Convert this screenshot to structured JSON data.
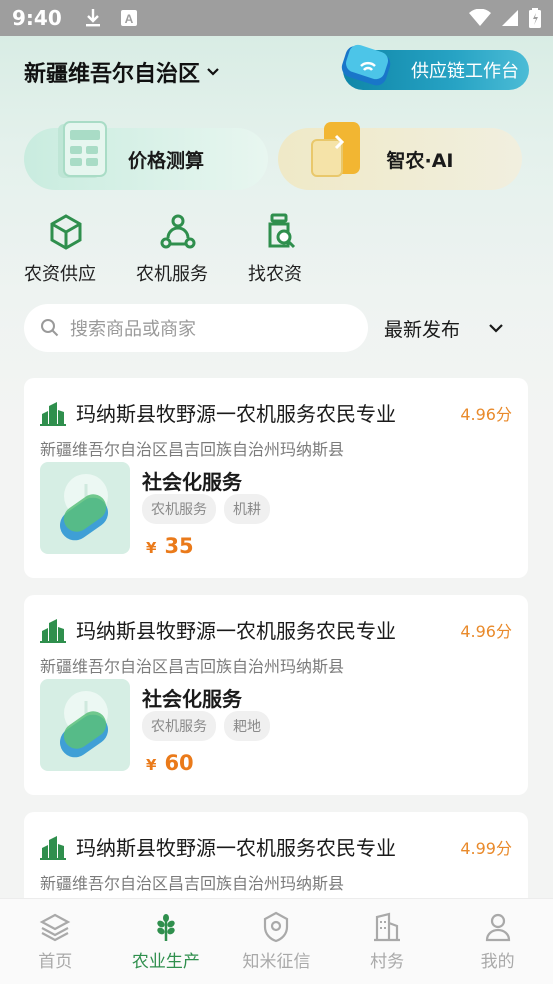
{
  "status_bar": {
    "time": "9:40"
  },
  "header": {
    "region": "新疆维吾尔自治区",
    "supply_chain_button": "供应链工作台"
  },
  "feature_cards": [
    {
      "label": "价格测算"
    },
    {
      "label": "智农·AI"
    }
  ],
  "quick_links": [
    {
      "label": "农资供应",
      "icon": "box-cube-icon"
    },
    {
      "label": "农机服务",
      "icon": "tractor-service-icon"
    },
    {
      "label": "找农资",
      "icon": "bottle-search-icon"
    }
  ],
  "search": {
    "placeholder": "搜索商品或商家",
    "sort_label": "最新发布"
  },
  "listings": [
    {
      "shop": "玛纳斯县牧野源一农机服务农民专业",
      "rating": "4.96分",
      "address": "新疆维吾尔自治区昌吉回族自治州玛纳斯县",
      "title": "社会化服务",
      "tags": [
        "农机服务",
        "机耕"
      ],
      "currency": "¥",
      "price": "35"
    },
    {
      "shop": "玛纳斯县牧野源一农机服务农民专业",
      "rating": "4.96分",
      "address": "新疆维吾尔自治区昌吉回族自治州玛纳斯县",
      "title": "社会化服务",
      "tags": [
        "农机服务",
        "耙地"
      ],
      "currency": "¥",
      "price": "60"
    },
    {
      "shop": "玛纳斯县牧野源一农机服务农民专业",
      "rating": "4.99分",
      "address": "新疆维吾尔自治区昌吉回族自治州玛纳斯县",
      "title": "",
      "tags": [],
      "currency": "",
      "price": ""
    }
  ],
  "tabs": [
    {
      "label": "首页",
      "icon": "layers-icon",
      "active": false
    },
    {
      "label": "农业生产",
      "icon": "wheat-icon",
      "active": true
    },
    {
      "label": "知米征信",
      "icon": "badge-icon",
      "active": false
    },
    {
      "label": "村务",
      "icon": "building-icon",
      "active": false
    },
    {
      "label": "我的",
      "icon": "person-icon",
      "active": false
    }
  ],
  "colors": {
    "accent_green": "#2f8f4d",
    "price_orange": "#ea7a1a",
    "rating_orange": "#e98a2b",
    "supply_blue": "#1a93b6"
  }
}
